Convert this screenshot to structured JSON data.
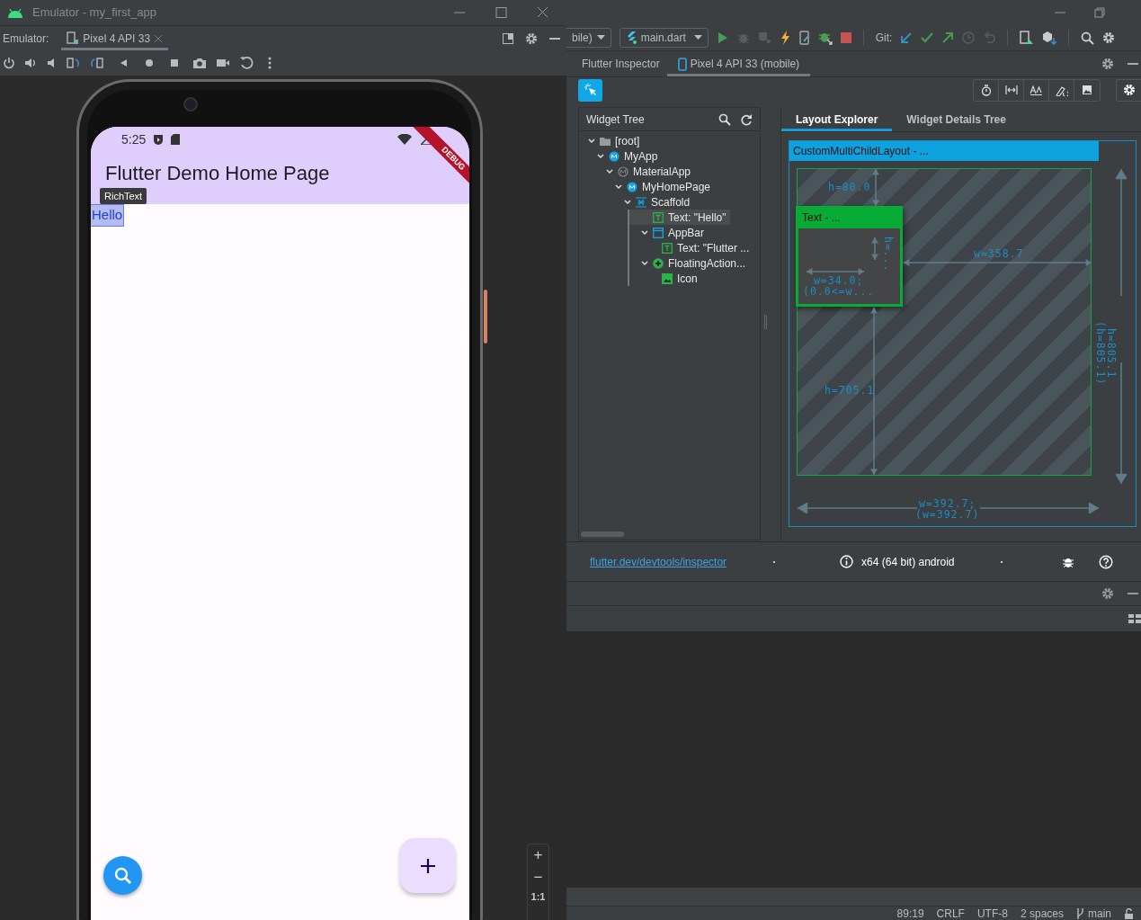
{
  "emulator": {
    "title": "Emulator - my_first_app",
    "label": "Emulator:",
    "tabs": [
      {
        "label": "Pixel 4 API 33",
        "selected": true
      }
    ]
  },
  "phone": {
    "time": "5:25",
    "app_bar_title": "Flutter Demo Home Page",
    "debug_banner": "DEBUG",
    "body_text": "Hello",
    "body_text_selected": true,
    "tooltip": "RichText"
  },
  "zoom_controls": [
    "+",
    "−",
    "1:1"
  ],
  "ide_toolbar": {
    "run_config": "bile)",
    "file": "main.dart",
    "git_label": "Git:"
  },
  "tool_window": {
    "title": "Flutter Inspector",
    "tabs": [
      {
        "label": "Pixel 4 API 33 (mobile)",
        "selected": true
      }
    ]
  },
  "inspector": {
    "select_mode": true,
    "widget_tree": {
      "title": "Widget Tree",
      "nodes": [
        {
          "label": "[root]",
          "kind": "folder",
          "expanded": true,
          "selected": false,
          "children": [
            {
              "label": "MyApp",
              "kind": "custom",
              "expanded": true,
              "selected": false,
              "children": [
                {
                  "label": "MaterialApp",
                  "kind": "material",
                  "expanded": true,
                  "selected": false,
                  "children": [
                    {
                      "label": "MyHomePage",
                      "kind": "custom",
                      "expanded": true,
                      "selected": false,
                      "children": [
                        {
                          "label": "Scaffold",
                          "kind": "scaffold",
                          "expanded": true,
                          "selected": false,
                          "children": [
                            {
                              "label": "Text: \"Hello\"",
                              "kind": "text",
                              "expanded": false,
                              "selected": true
                            },
                            {
                              "label": "AppBar",
                              "kind": "appbar",
                              "expanded": true,
                              "selected": false,
                              "children": [
                                {
                                  "label": "Text: \"Flutter ...",
                                  "kind": "text",
                                  "expanded": false,
                                  "selected": false
                                }
                              ]
                            },
                            {
                              "label": "FloatingAction...",
                              "kind": "fab",
                              "expanded": true,
                              "selected": false,
                              "children": [
                                {
                                  "label": "Icon",
                                  "kind": "image",
                                  "expanded": false,
                                  "selected": false
                                }
                              ]
                            }
                          ]
                        }
                      ]
                    }
                  ]
                }
              ]
            }
          ]
        }
      ]
    },
    "detail_tabs": [
      {
        "label": "Layout Explorer",
        "selected": true
      },
      {
        "label": "Widget Details Tree",
        "selected": false
      }
    ],
    "layout": {
      "title": "CustomMultiChildLayout - ...",
      "child_title": "Text - ...",
      "labels": [
        {
          "kind": "top",
          "lines": [
            "h=80.0"
          ]
        },
        {
          "kind": "child_h",
          "lines": [
            "h=..."
          ]
        },
        {
          "kind": "child_w",
          "lines": [
            "w=34.0;",
            "(0.0<=w..."
          ]
        },
        {
          "kind": "right",
          "lines": [
            "w=358.7"
          ]
        },
        {
          "kind": "bottom",
          "lines": [
            "h=705.1"
          ]
        },
        {
          "kind": "height",
          "lines": [
            "h=805.1",
            "(h=805.1)"
          ]
        },
        {
          "kind": "width",
          "lines": [
            "w=392.7;",
            "(w=392.7)"
          ]
        }
      ]
    }
  },
  "info_bar": {
    "link": "flutter.dev/devtools/inspector",
    "platform": "x64 (64 bit) android"
  },
  "status_bar": [
    "89:19",
    "CRLF",
    "UTF-8",
    "2 spaces",
    "main"
  ]
}
